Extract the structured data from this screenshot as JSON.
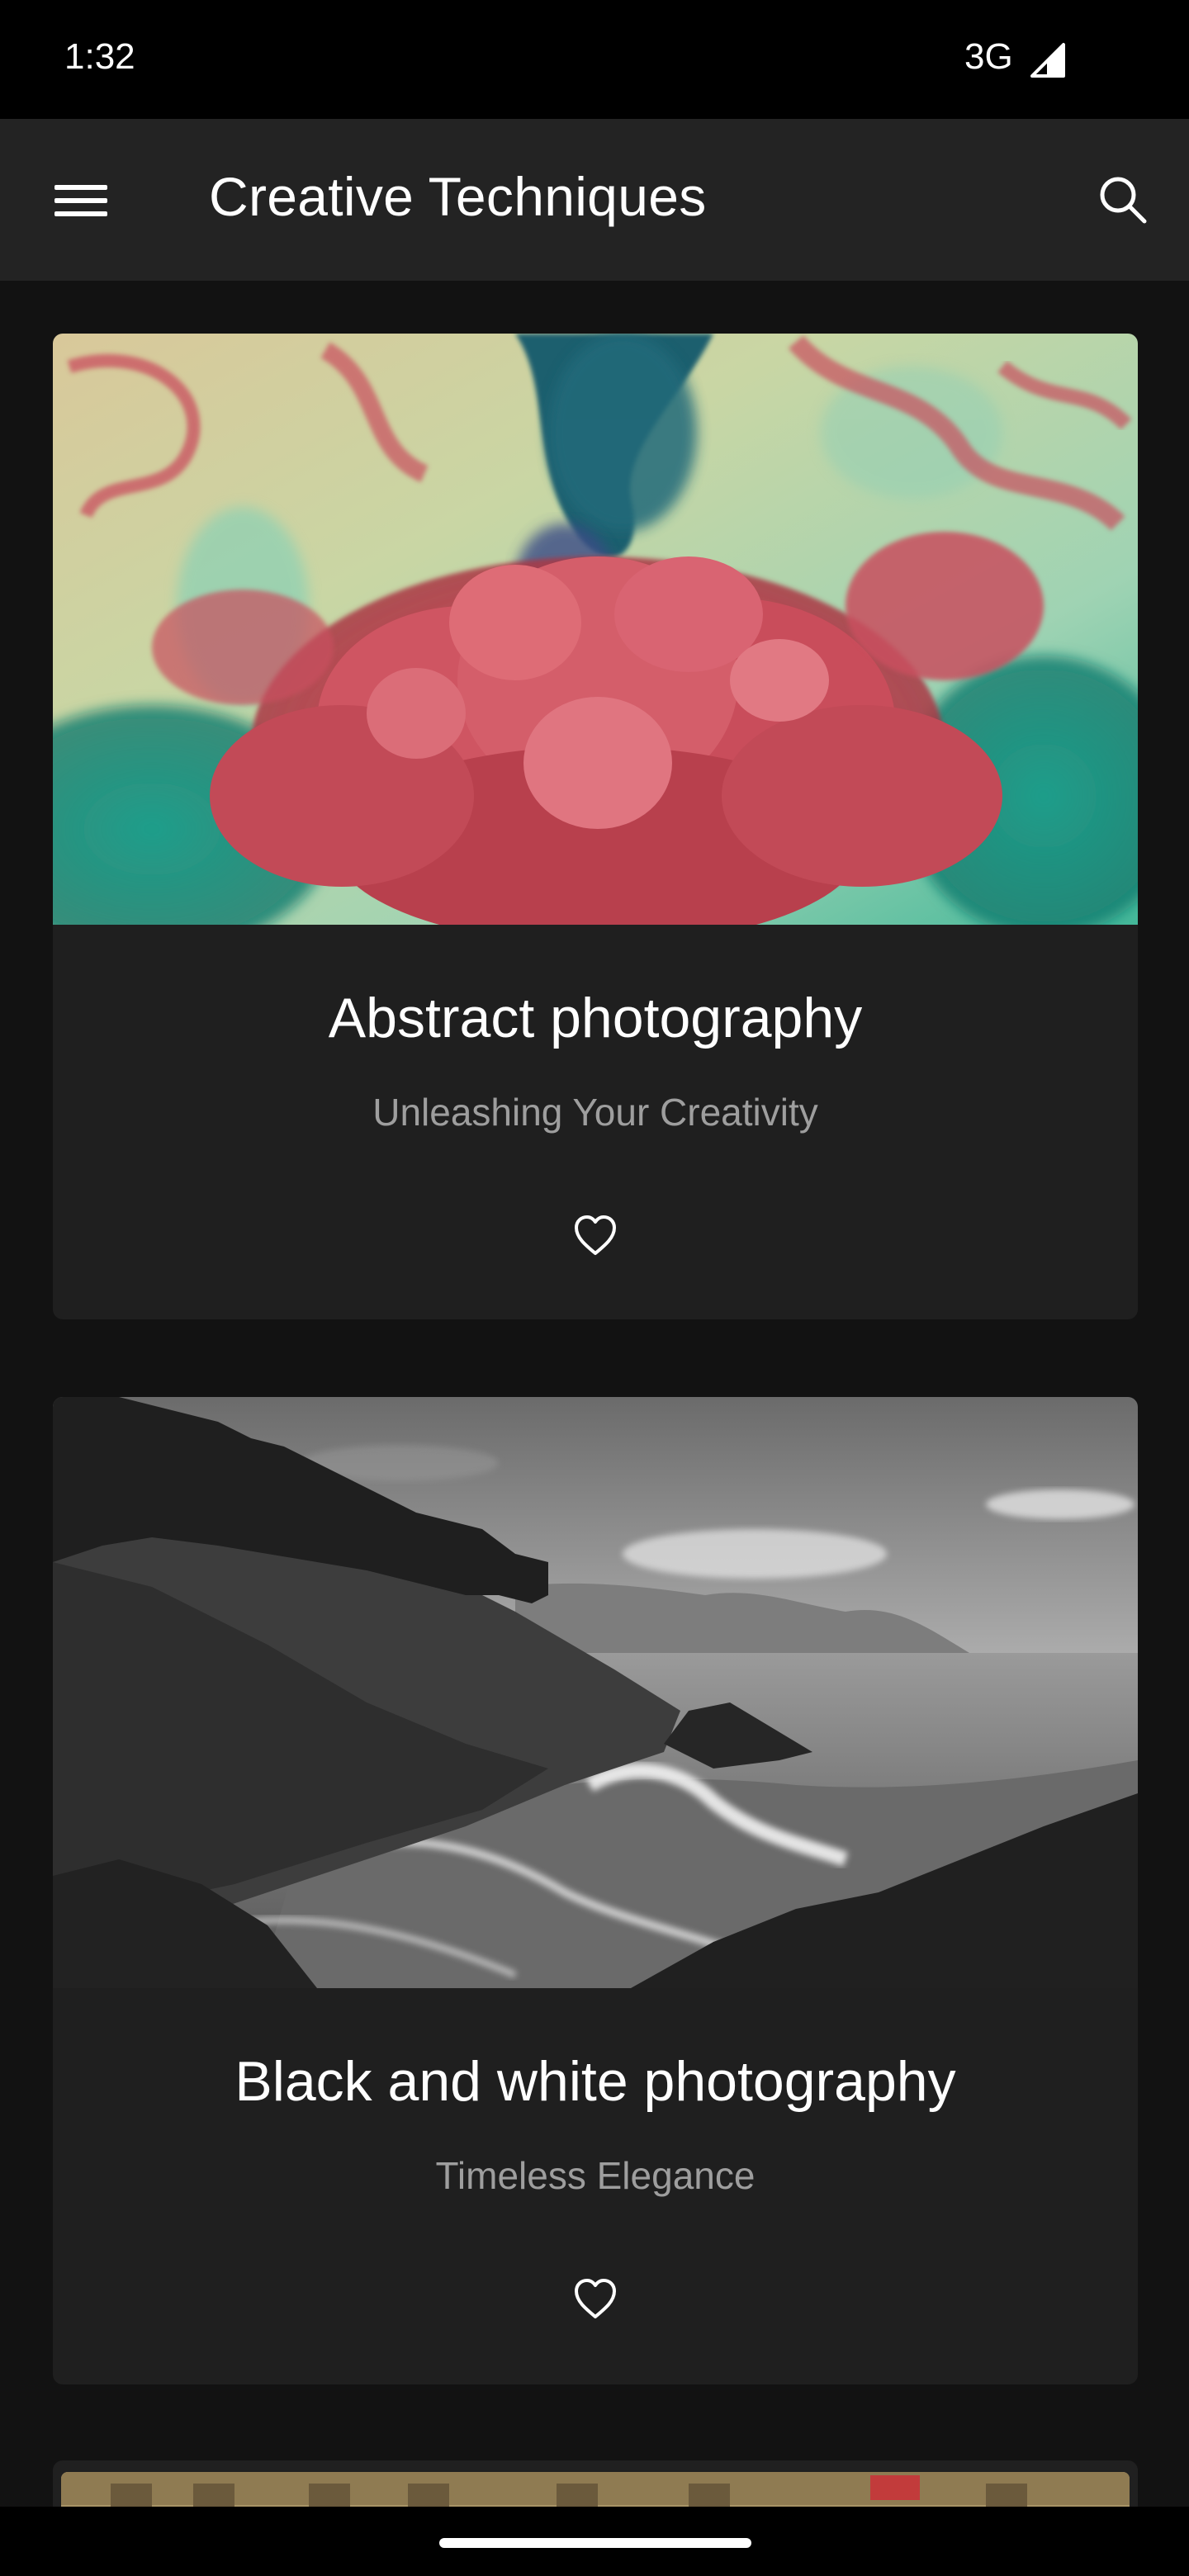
{
  "status_bar": {
    "time": "1:32",
    "network": "3G",
    "signal_icon": "cellular-signal-icon"
  },
  "app_bar": {
    "title": "Creative Techniques",
    "menu_icon": "hamburger-menu-icon",
    "search_icon": "search-icon"
  },
  "cards": [
    {
      "title": "Abstract photography",
      "subtitle": "Unleashing Your Creativity",
      "image": "abstract-ink-smoke-photo",
      "favorite_icon": "heart-outline-icon"
    },
    {
      "title": "Black and white photography",
      "subtitle": "Timeless Elegance",
      "image": "black-and-white-coastline-photo",
      "favorite_icon": "heart-outline-icon"
    },
    {
      "image": "street-building-photo-partial"
    }
  ],
  "colors": {
    "background": "#121212",
    "app_bar": "#232323",
    "card": "#1f1f1f",
    "subtitle": "#9e9e9e",
    "status_bar": "#000000"
  }
}
